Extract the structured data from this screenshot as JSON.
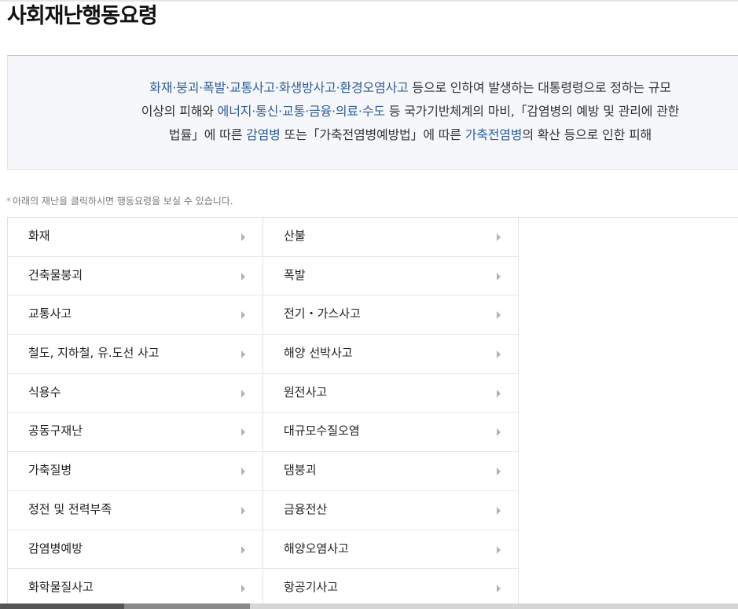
{
  "title": "사회재난행동요령",
  "definition": {
    "line1_pre": "",
    "line1_hl": "화재·붕괴·폭발·교통사고·화생방사고·환경오염사고",
    "line1_post": " 등으로 인하여 발생하는 대통령령으로 정하는 규모",
    "line2_pre": "이상의 피해와 ",
    "line2_hl": "에너지·통신·교통·금융·의료·수도",
    "line2_post": " 등 국가기반체계의 마비,「감염병의 예방 및 관리에 관한",
    "line3_pre": "법률」에 따른 ",
    "line3_hl1": "감염병",
    "line3_mid": " 또는「가축전염병예방법」에 따른 ",
    "line3_hl2": "가축전염병",
    "line3_post": "의 확산 등으로 인한 피해"
  },
  "notice": {
    "star": "*",
    "text": "아래의 재난을 클릭하시면 행동요령을 보실 수 있습니다."
  },
  "disasters": [
    [
      "화재",
      "산불"
    ],
    [
      "건축물붕괴",
      "폭발"
    ],
    [
      "교통사고",
      "전기・가스사고"
    ],
    [
      "철도, 지하철, 유.도선 사고",
      "해양 선박사고"
    ],
    [
      "식용수",
      "원전사고"
    ],
    [
      "공동구재난",
      "대규모수질오염"
    ],
    [
      "가축질병",
      "댐붕괴"
    ],
    [
      "정전 및 전력부족",
      "금융전산"
    ],
    [
      "감염병예방",
      "해양오염사고"
    ],
    [
      "화학물질사고",
      "항공기사고"
    ]
  ],
  "icons": {
    "cell_arrow": "chevron-right-icon"
  },
  "colors": {
    "highlight": "#2f5d9c",
    "definition_bg": "#f5f7fa"
  }
}
